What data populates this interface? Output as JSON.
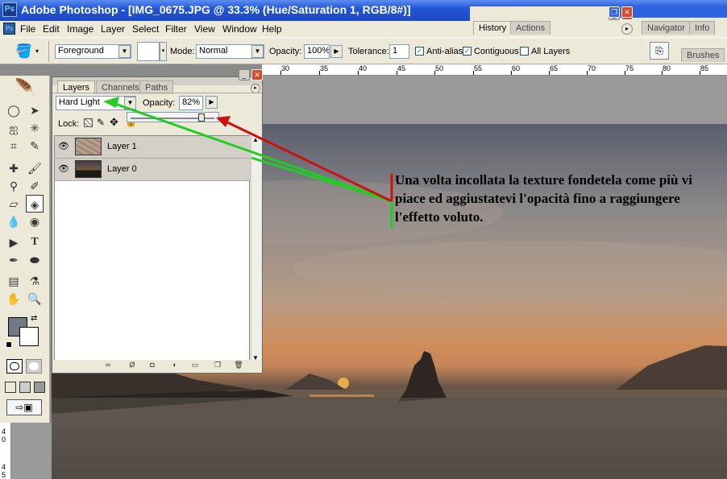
{
  "window": {
    "title": "Adobe Photoshop - [IMG_0675.JPG @ 33.3% (Hue/Saturation 1, RGB/8#)]"
  },
  "menu": [
    "File",
    "Edit",
    "Image",
    "Layer",
    "Select",
    "Filter",
    "View",
    "Window",
    "Help"
  ],
  "palette_tabs": {
    "history": "History",
    "actions": "Actions",
    "navigator": "Navigator",
    "info": "Info",
    "brushes": "Brushes"
  },
  "options": {
    "fill_source": "Foreground",
    "mode_label": "Mode:",
    "mode_value": "Normal",
    "opacity_label": "Opacity:",
    "opacity_value": "100%",
    "tolerance_label": "Tolerance:",
    "tolerance_value": "1",
    "anti_alias": "Anti-alias",
    "contiguous": "Contiguous",
    "all_layers": "All Layers"
  },
  "ruler": {
    "top": [
      "30",
      "35",
      "40",
      "45",
      "50",
      "55",
      "60",
      "65",
      "70",
      "75",
      "80",
      "85"
    ],
    "left": [
      "4",
      "0",
      "4",
      "5"
    ]
  },
  "layers_panel": {
    "tabs": [
      "Layers",
      "Channels",
      "Paths"
    ],
    "blend_mode": "Hard Light",
    "opacity_label": "Opacity:",
    "opacity_value": "82%",
    "lock_label": "Lock:",
    "layers": [
      {
        "name": "Layer 1"
      },
      {
        "name": "Layer 0"
      }
    ]
  },
  "annotation": {
    "text": "Una volta incollata la texture fondetela come più vi piace ed aggiustatevi l'opacità fino a raggiungere l'effetto voluto."
  },
  "colors": {
    "foreground": "#6e7a84",
    "background": "#ffffff",
    "accent_green": "#22cc22",
    "accent_red": "#cc1111"
  }
}
